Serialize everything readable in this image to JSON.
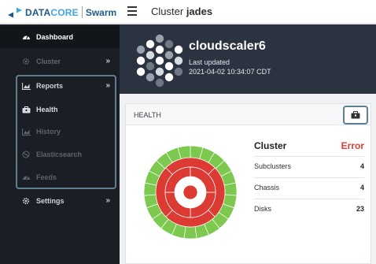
{
  "brand": {
    "name_part1": "DATA",
    "name_part2": "CORE",
    "product": "Swarm",
    "colors": {
      "navy": "#1f5a8a",
      "sky": "#3fa7e0"
    }
  },
  "header": {
    "prefix": "Cluster",
    "cluster_name": "jades"
  },
  "sidebar": {
    "items": [
      {
        "label": "Dashboard",
        "icon": "dashboard-gauge-icon",
        "chevron": ""
      },
      {
        "label": "Cluster",
        "icon": "cluster-gear-icon",
        "chevron": "»"
      },
      {
        "label": "Reports",
        "icon": "reports-chart-icon",
        "chevron": "»"
      },
      {
        "label": "Health",
        "icon": "health-briefcase-icon",
        "chevron": ""
      },
      {
        "label": "History",
        "icon": "history-chart-icon",
        "chevron": ""
      },
      {
        "label": "Elasticsearch",
        "icon": "elasticsearch-icon",
        "chevron": ""
      },
      {
        "label": "Feeds",
        "icon": "feeds-gauge-icon",
        "chevron": ""
      },
      {
        "label": "Settings",
        "icon": "settings-gear-icon",
        "chevron": "»"
      }
    ]
  },
  "hero": {
    "name": "cloudscaler6",
    "updated_label": "Last updated",
    "updated_value": "2021-04-02 10:34:07 CDT"
  },
  "health": {
    "title": "HEALTH",
    "cluster_label": "Cluster",
    "status": "Error",
    "status_color": "#dc3b34",
    "rows": [
      {
        "label": "Subclusters",
        "value": "4"
      },
      {
        "label": "Chassis",
        "value": "4"
      },
      {
        "label": "Disks",
        "value": "23"
      }
    ],
    "ring_colors": {
      "error": "#dc3b34",
      "ok": "#7dc84f"
    }
  }
}
